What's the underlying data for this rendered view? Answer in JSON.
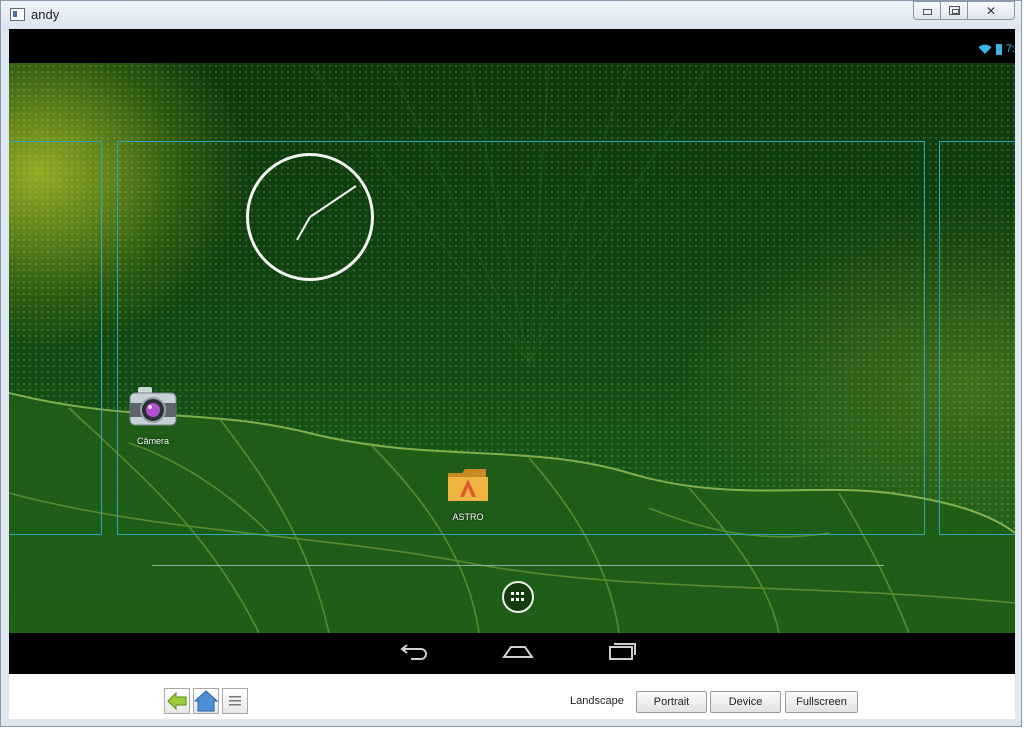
{
  "window": {
    "title": "andy",
    "min_icon": "minimize-icon",
    "max_icon": "maximize-icon",
    "close_icon": "close-icon"
  },
  "status_bar": {
    "wifi_icon": "wifi-icon",
    "battery_icon": "battery-icon",
    "time": "7:"
  },
  "home": {
    "shortcuts": [
      {
        "label": "Câmera",
        "icon": "camera-icon"
      },
      {
        "label": "ASTRO",
        "icon": "astro-folder-icon"
      }
    ],
    "widget": "analog-clock-widget",
    "apps_icon": "app-drawer-icon"
  },
  "nav": {
    "back": "back-icon",
    "home": "home-icon",
    "recents": "recent-apps-icon"
  },
  "toolbar": {
    "icons": [
      "back-arrow-icon",
      "home-icon",
      "menu-icon"
    ],
    "landscape_label": "Landscape",
    "portrait_label": "Portrait",
    "device_label": "Device",
    "fullscreen_label": "Fullscreen"
  },
  "colors": {
    "accent": "#33b5e5",
    "panel_outline": "#2ca8b7",
    "wallpaper": "#135214"
  }
}
